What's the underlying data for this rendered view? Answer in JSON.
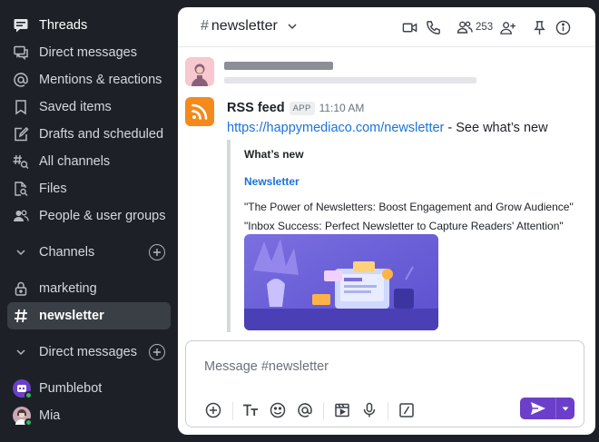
{
  "sidebar": {
    "items": [
      {
        "label": "Threads",
        "icon": "threads-icon"
      },
      {
        "label": "Direct messages",
        "icon": "direct-messages-icon"
      },
      {
        "label": "Mentions & reactions",
        "icon": "at-icon"
      },
      {
        "label": "Saved items",
        "icon": "bookmark-icon"
      },
      {
        "label": "Drafts and scheduled",
        "icon": "pencil-icon"
      },
      {
        "label": "All channels",
        "icon": "channel-search-icon"
      },
      {
        "label": "Files",
        "icon": "file-search-icon"
      },
      {
        "label": "People & user groups",
        "icon": "people-icon"
      }
    ],
    "channels_section": "Channels",
    "channels": [
      {
        "name": "marketing",
        "icon": "lock-icon"
      },
      {
        "name": "newsletter",
        "icon": "hash-icon"
      }
    ],
    "dm_section": "Direct messages",
    "dms": [
      {
        "name": "Pumblebot"
      },
      {
        "name": "Mia"
      }
    ]
  },
  "header": {
    "hash": "#",
    "channel": "newsletter",
    "member_count": "253"
  },
  "message": {
    "sender": "RSS feed",
    "badge": "APP",
    "time": "11:10 AM",
    "link": "https://happymediaco.com/newsletter",
    "text_suffix": " - See what’s new",
    "card": {
      "title": "What’s new",
      "link": "Newsletter",
      "line1": "\"The Power of Newsletters: Boost Engagement and Grow Audience\"",
      "line2": " \"Inbox Success: Perfect Newsletter to Capture Readers' Attention\""
    }
  },
  "composer": {
    "placeholder": "Message #newsletter"
  },
  "colors": {
    "sidebar_bg": "#1d2127",
    "accent": "#6b3fc9",
    "link": "#1a73d9",
    "rss": "#f38a1b"
  }
}
